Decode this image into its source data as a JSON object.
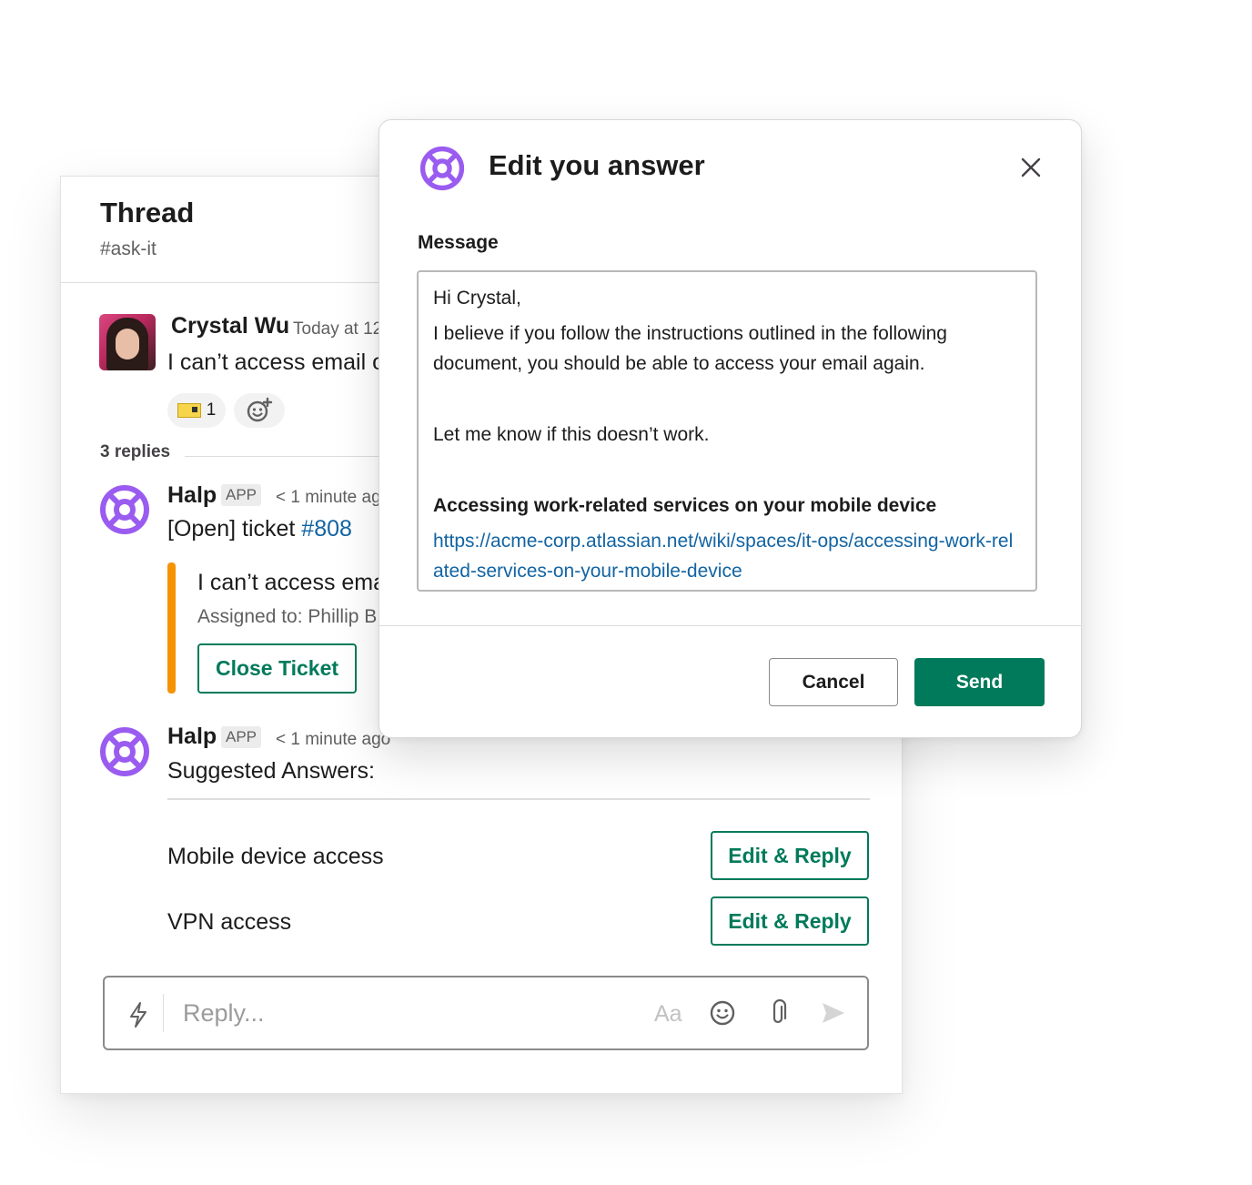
{
  "colors": {
    "accent_green": "#007a5a",
    "link_blue": "#1264a3",
    "ticket_orange": "#f59300",
    "halp_purple": "#9a5cf0"
  },
  "thread": {
    "title": "Thread",
    "channel": "#ask-it",
    "original_message": {
      "author": "Crystal Wu",
      "time": "Today at 12",
      "text": "I can’t access email o",
      "reaction_count": "1",
      "reaction_icon": "sticker-emoji-icon",
      "add_reaction_icon": "add-reaction-icon"
    },
    "replies_label": "3 replies",
    "reply_1": {
      "author": "Halp",
      "badge": "APP",
      "time": "< 1 minute ag",
      "text_prefix": "[Open] ticket ",
      "ticket_link": "#808",
      "attachment_title": "I can’t access ema",
      "attachment_assigned": "Assigned to: Phillip B",
      "close_button": "Close Ticket"
    },
    "reply_2": {
      "author": "Halp",
      "badge": "APP",
      "time": "< 1 minute ago",
      "text": "Suggested Answers:",
      "suggestions": [
        {
          "label": "Mobile device access",
          "button": "Edit & Reply"
        },
        {
          "label": "VPN access",
          "button": "Edit & Reply"
        }
      ]
    },
    "composer": {
      "placeholder": "Reply...",
      "format_label": "Aa",
      "icons": [
        "lightning-icon",
        "emoji-icon",
        "attachment-icon",
        "send-icon"
      ]
    }
  },
  "modal": {
    "title": "Edit you answer",
    "message_label": "Message",
    "message": {
      "greeting": "Hi Crystal,",
      "body": "I believe if you follow the instructions outlined in the following document, you should be able to access your email again.",
      "followup": "Let me know if this doesn’t work.",
      "doc_title": "Accessing work-related services on your mobile device",
      "doc_link": "https://acme-corp.atlassian.net/wiki/spaces/it-ops/accessing-work-related-services-on-your-mobile-device"
    },
    "cancel_label": "Cancel",
    "send_label": "Send"
  }
}
